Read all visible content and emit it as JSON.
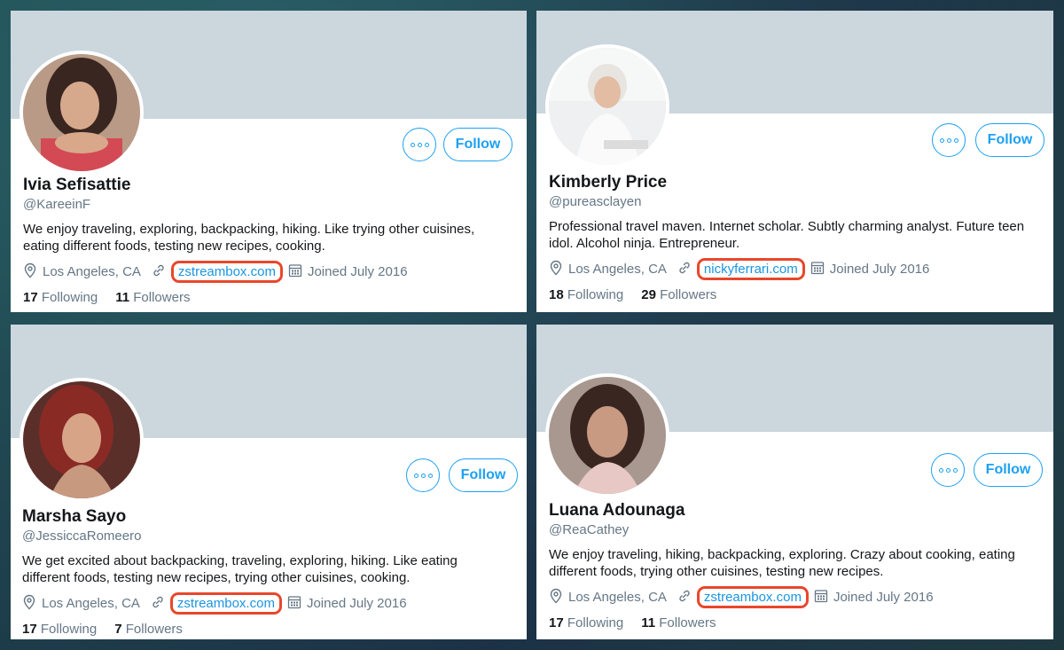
{
  "profiles": [
    {
      "name": "Ivia Sefisattie",
      "handle": "@KareeinF",
      "bio": "We enjoy traveling, exploring, backpacking, hiking. Like trying other cuisines, eating different foods, testing new recipes, cooking.",
      "location": "Los Angeles, CA",
      "website": "zstreambox.com",
      "joined": "Joined July 2016",
      "following_count": "17",
      "following_label": "Following",
      "followers_count": "11",
      "followers_label": "Followers",
      "follow_label": "Follow"
    },
    {
      "name": "Kimberly Price",
      "handle": "@pureasclayen",
      "bio": "Professional travel maven. Internet scholar. Subtly charming analyst. Future teen idol. Alcohol ninja. Entrepreneur.",
      "location": "Los Angeles, CA",
      "website": "nickyferrari.com",
      "joined": "Joined July 2016",
      "following_count": "18",
      "following_label": "Following",
      "followers_count": "29",
      "followers_label": "Followers",
      "follow_label": "Follow"
    },
    {
      "name": "Marsha Sayo",
      "handle": "@JessiccaRomeero",
      "bio": "We get excited about backpacking, traveling, exploring, hiking. Like eating different foods, testing new recipes, trying other cuisines, cooking.",
      "location": "Los Angeles, CA",
      "website": "zstreambox.com",
      "joined": "Joined July 2016",
      "following_count": "17",
      "following_label": "Following",
      "followers_count": "7",
      "followers_label": "Followers",
      "follow_label": "Follow"
    },
    {
      "name": "Luana Adounaga",
      "handle": "@ReaCathey",
      "bio": "We enjoy traveling, hiking, backpacking, exploring. Crazy about cooking, eating different foods, trying other cuisines, testing new recipes.",
      "location": "Los Angeles, CA",
      "website": "zstreambox.com",
      "joined": "Joined July 2016",
      "following_count": "17",
      "following_label": "Following",
      "followers_count": "11",
      "followers_label": "Followers",
      "follow_label": "Follow"
    }
  ],
  "colors": {
    "accent": "#1da1f2",
    "link": "#1b95e0",
    "highlight": "#e8472c",
    "banner": "#ccd6dd"
  },
  "icons": [
    "location-pin-icon",
    "link-icon",
    "calendar-icon",
    "more-options-icon"
  ]
}
